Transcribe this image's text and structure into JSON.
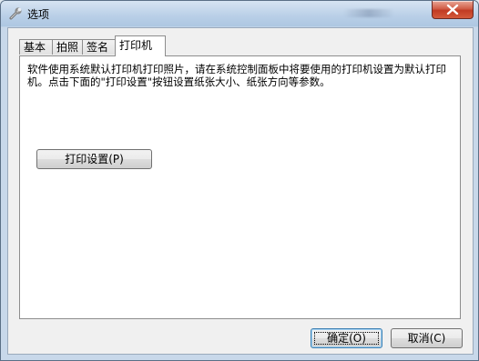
{
  "window": {
    "title": "选项",
    "title_icon": "wrench-icon",
    "close_icon": "close-icon"
  },
  "tabs": [
    {
      "label": "基本",
      "active": false
    },
    {
      "label": "拍照",
      "active": false
    },
    {
      "label": "签名",
      "active": false
    },
    {
      "label": "打印机",
      "active": true
    }
  ],
  "printer_tab": {
    "description": "软件使用系统默认打印机打印照片，请在系统控制面板中将要使用的打印机设置为默认打印机。点击下面的\"打印设置\"按钮设置纸张大小、纸张方向等参数。",
    "print_settings_button": "打印设置(P)"
  },
  "footer": {
    "ok_button": "确定(O)",
    "cancel_button": "取消(C)"
  },
  "colors": {
    "titlebar": "#b9cfe7",
    "close_button": "#c13b23",
    "default_button_border": "#3c7fb1"
  }
}
